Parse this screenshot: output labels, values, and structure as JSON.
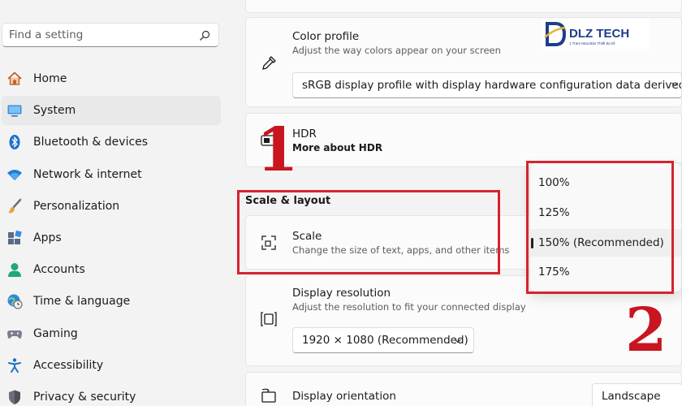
{
  "search": {
    "placeholder": "Find a setting",
    "icon": "search-icon"
  },
  "sidebar": {
    "items": [
      {
        "label": "Home",
        "icon": "home-icon",
        "active": false
      },
      {
        "label": "System",
        "icon": "system-icon",
        "active": true
      },
      {
        "label": "Bluetooth & devices",
        "icon": "bluetooth-icon",
        "active": false
      },
      {
        "label": "Network & internet",
        "icon": "wifi-icon",
        "active": false
      },
      {
        "label": "Personalization",
        "icon": "brush-icon",
        "active": false
      },
      {
        "label": "Apps",
        "icon": "apps-icon",
        "active": false
      },
      {
        "label": "Accounts",
        "icon": "accounts-icon",
        "active": false
      },
      {
        "label": "Time & language",
        "icon": "globe-clock-icon",
        "active": false
      },
      {
        "label": "Gaming",
        "icon": "gamepad-icon",
        "active": false
      },
      {
        "label": "Accessibility",
        "icon": "accessibility-icon",
        "active": false
      },
      {
        "label": "Privacy & security",
        "icon": "shield-icon",
        "active": false
      }
    ]
  },
  "color_profile": {
    "title": "Color profile",
    "subtitle": "Adjust the way colors appear on your screen",
    "icon": "eyedropper-icon",
    "selected": "sRGB display profile with display hardware configuration data derived fron"
  },
  "hdr": {
    "title": "HDR",
    "link": "More about HDR",
    "icon": "hdr-icon"
  },
  "scale_layout": {
    "label": "Scale & layout",
    "scale": {
      "title": "Scale",
      "subtitle": "Change the size of text, apps, and other items",
      "icon": "scale-icon"
    },
    "resolution": {
      "title": "Display resolution",
      "subtitle": "Adjust the resolution to fit your connected display",
      "icon": "resolution-icon",
      "selected": "1920 × 1080 (Recommended)"
    },
    "orientation": {
      "title": "Display orientation",
      "icon": "orientation-icon",
      "selected": "Landscape"
    }
  },
  "scale_dropdown": {
    "options": [
      "100%",
      "125%",
      "150% (Recommended)",
      "175%"
    ],
    "selected_index": 2
  },
  "annotations": {
    "step1": "1",
    "step2": "2"
  },
  "logo": {
    "text": "DLZ TECH",
    "tagline": "1 Tram Mua Bán Thiết Bị Số",
    "brand_color": "#1d3e8a",
    "accent_color": "#e8b33a"
  },
  "colors": {
    "annotation_red": "#d5232e",
    "accent_blue": "#1a73c8"
  }
}
